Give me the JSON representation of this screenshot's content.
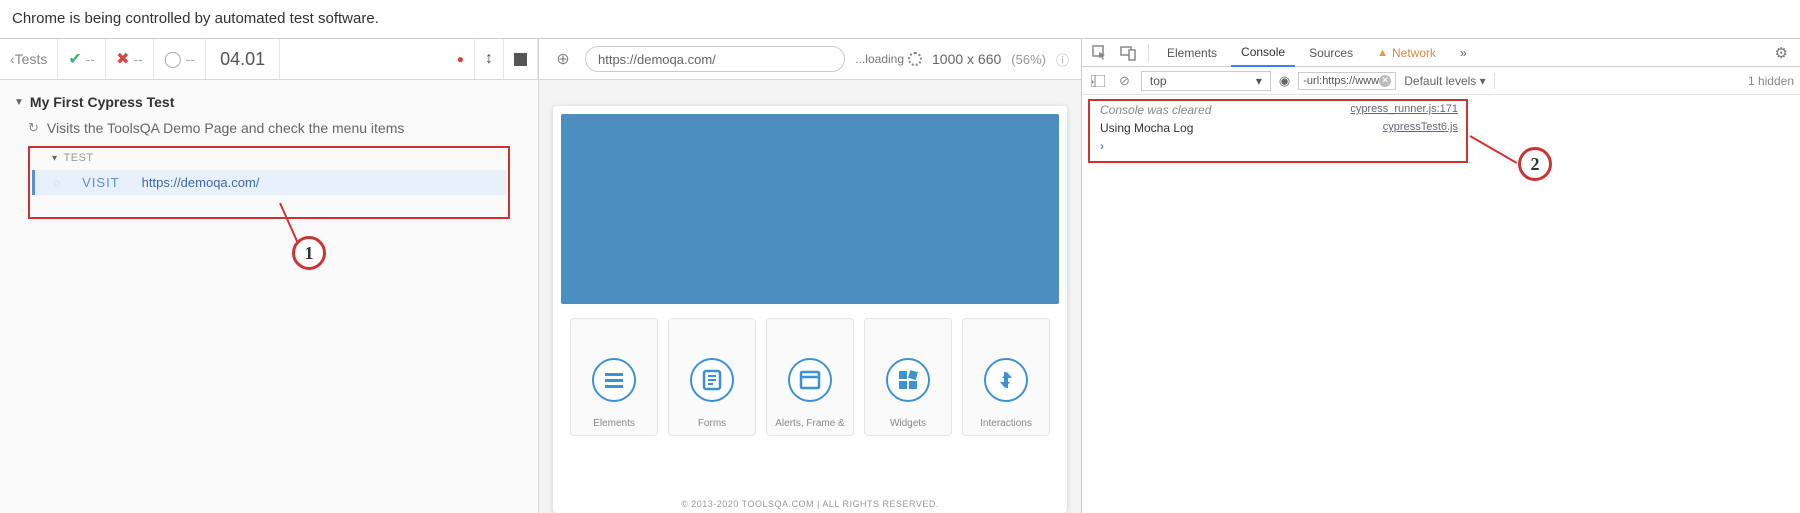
{
  "banner": "Chrome is being controlled by automated test software.",
  "cypress": {
    "back": "Tests",
    "pass_count": "--",
    "fail_count": "--",
    "pend_count": "--",
    "timer": "04.01",
    "spec": "My First Cypress Test",
    "test": "Visits the ToolsQA Demo Page and check the menu items",
    "section": "TEST",
    "cmd": "VISIT",
    "cmd_arg": "https://demoqa.com/",
    "callout1": "1"
  },
  "preview": {
    "url": "https://demoqa.com/",
    "loading": "...loading",
    "dims": "1000 x 660",
    "scale": "(56%)",
    "cards": [
      "Elements",
      "Forms",
      "Alerts, Frame &",
      "Widgets",
      "Interactions"
    ],
    "footer": "© 2013-2020 TOOLSQA.COM | ALL RIGHTS RESERVED."
  },
  "devtools": {
    "tabs": {
      "elements": "Elements",
      "console": "Console",
      "sources": "Sources",
      "network": "Network",
      "more": "»"
    },
    "filter": {
      "context": "top",
      "url_filter": "-url:https://www",
      "levels": "Default levels ▾",
      "hidden": "1 hidden"
    },
    "console": {
      "line1": "Console was cleared",
      "src1": "cypress_runner.js:171",
      "line2": "Using Mocha Log",
      "src2": "cypressTest6.js",
      "callout2": "2"
    }
  }
}
